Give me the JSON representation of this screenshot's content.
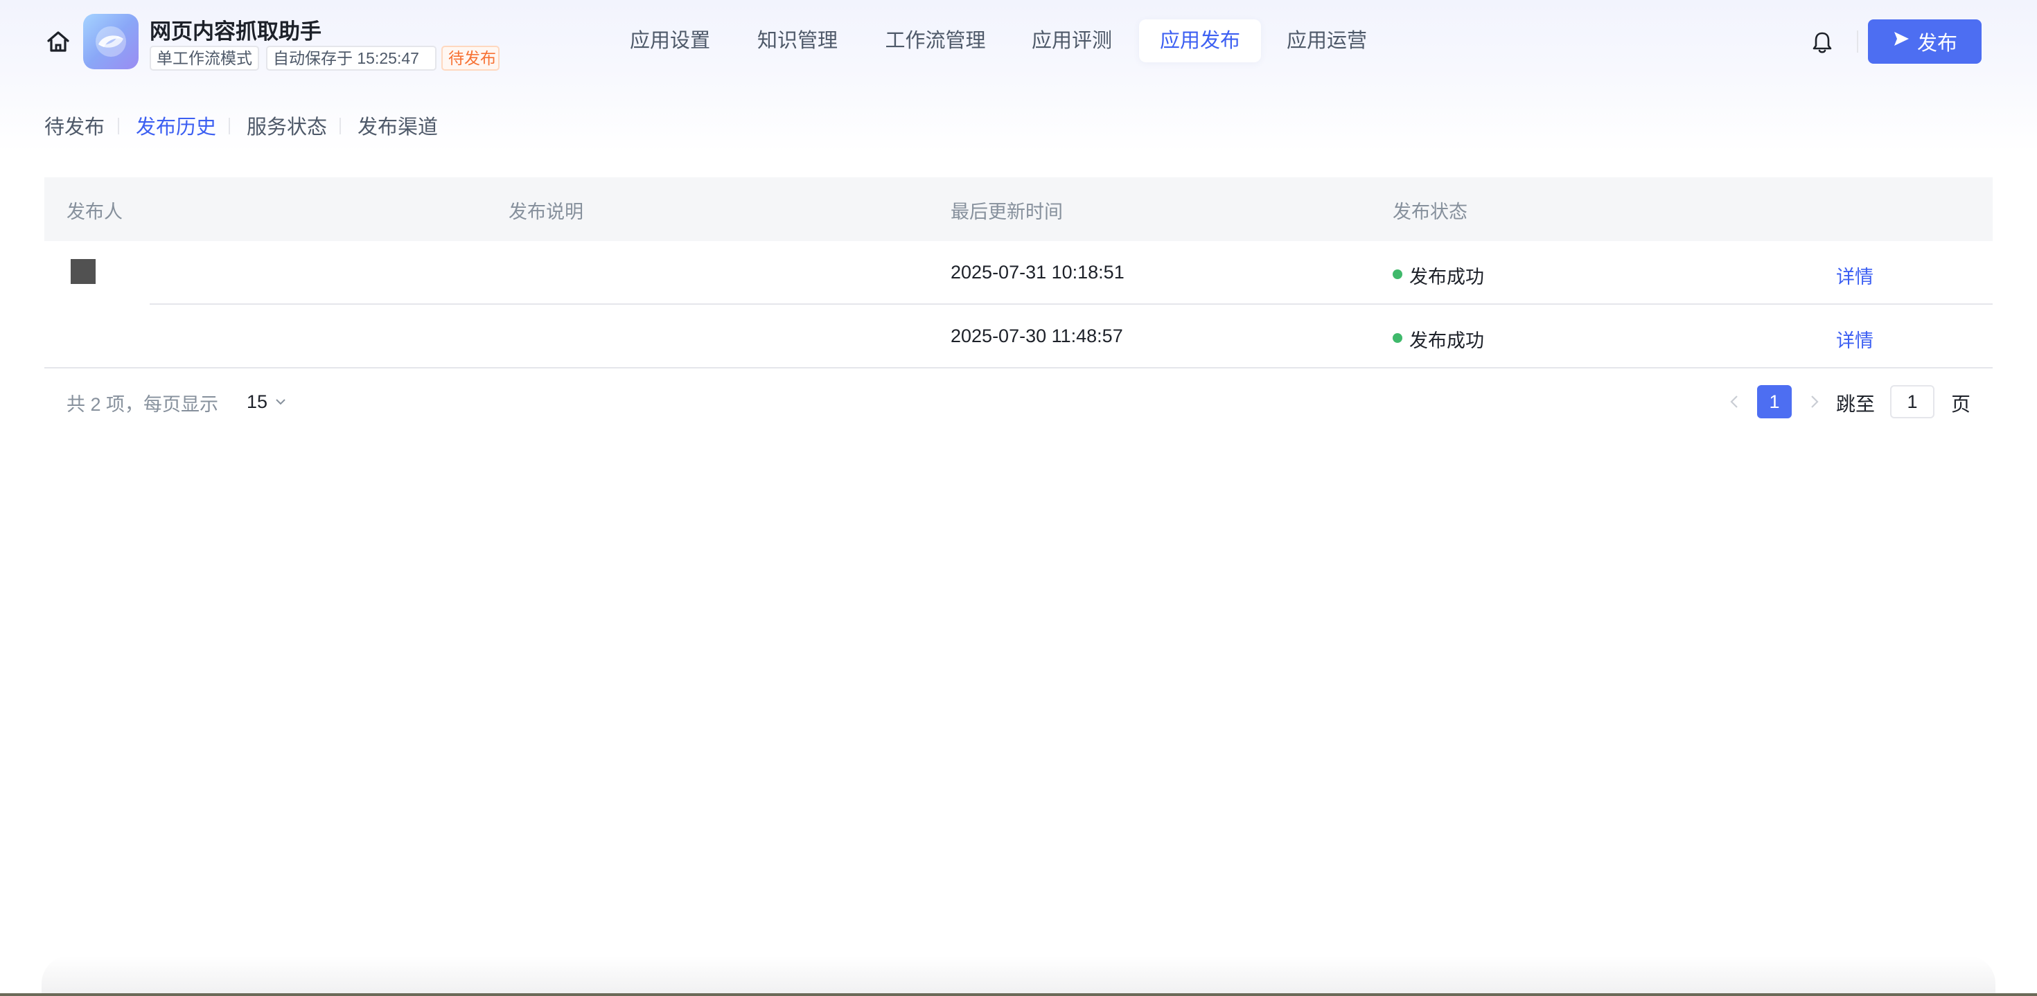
{
  "header": {
    "app_title": "网页内容抓取助手",
    "tags": {
      "mode": "单工作流模式",
      "autosave": "自动保存于 15:25:47",
      "status": "待发布"
    },
    "nav": [
      {
        "label": "应用设置",
        "active": false
      },
      {
        "label": "知识管理",
        "active": false
      },
      {
        "label": "工作流管理",
        "active": false
      },
      {
        "label": "应用评测",
        "active": false
      },
      {
        "label": "应用发布",
        "active": true
      },
      {
        "label": "应用运营",
        "active": false
      }
    ],
    "publish_button": "发布",
    "icons": {
      "home": "home-icon",
      "bell": "bell-icon",
      "publish": "send-icon"
    }
  },
  "subtabs": [
    {
      "label": "待发布",
      "active": false
    },
    {
      "label": "发布历史",
      "active": true
    },
    {
      "label": "服务状态",
      "active": false
    },
    {
      "label": "发布渠道",
      "active": false
    }
  ],
  "table": {
    "columns": [
      "发布人",
      "发布说明",
      "最后更新时间",
      "发布状态"
    ],
    "rows": [
      {
        "publisher": "",
        "description": "",
        "updated": "2025-07-31 10:18:51",
        "status": "发布成功",
        "action": "详情"
      },
      {
        "publisher": "",
        "description": "",
        "updated": "2025-07-30 11:48:57",
        "status": "发布成功",
        "action": "详情"
      }
    ],
    "status_color": "#3fb96b"
  },
  "pagination": {
    "summary": "共 2 项，每页显示",
    "page_size": "15",
    "current_page": "1",
    "jump_label": "跳至",
    "jump_value": "1",
    "page_suffix": "页"
  },
  "colors": {
    "accent": "#3c5ff2",
    "primary_button": "#4d6ef2",
    "pending_tag": "#f77234"
  }
}
